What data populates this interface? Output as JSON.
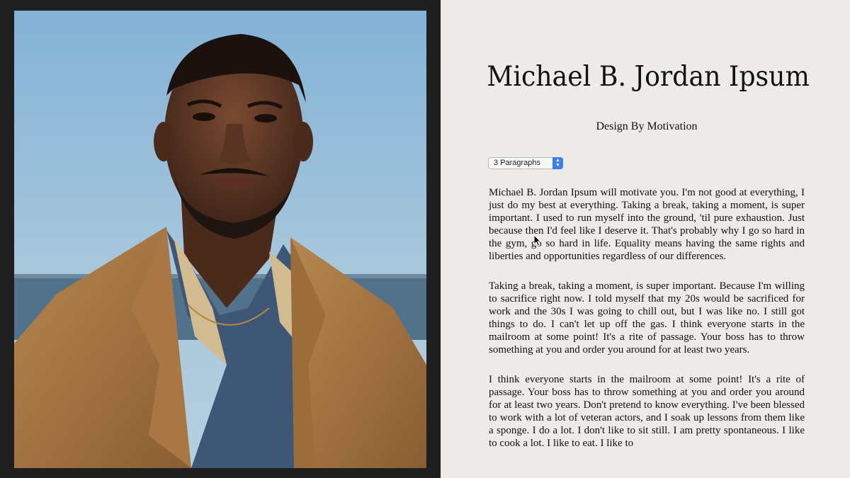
{
  "page": {
    "title": "Michael B. Jordan Ipsum",
    "subtitle": "Design By Motivation"
  },
  "controls": {
    "paragraph_select": {
      "selected": "3 Paragraphs"
    }
  },
  "content": {
    "paragraphs": [
      "Michael B. Jordan Ipsum will motivate you. I'm not good at everything, I just do my best at everything. Taking a break, taking a moment, is super important. I used to run myself into the ground, 'til pure exhaustion. Just because then I'd feel like I deserve it. That's probably why I go so hard in the gym, go so hard in life. Equality means having the same rights and liberties and opportunities regardless of our differences.",
      "Taking a break, taking a moment, is super important. Because I'm willing to sacrifice right now. I told myself that my 20s would be sacrificed for work and the 30s I was going to chill out, but I was like no. I still got things to do. I can't let up off the gas. I think everyone starts in the mailroom at some point! It's a rite of passage. Your boss has to throw something at you and order you around for at least two years.",
      "I think everyone starts in the mailroom at some point! It's a rite of passage. Your boss has to throw something at you and order you around for at least two years. Don't pretend to know everything. I've been blessed to work with a lot of veteran actors, and I soak up lessons from them like a sponge. I do a lot. I don't like to sit still. I am pretty spontaneous. I like to cook a lot. I like to eat. I like to"
    ]
  },
  "colors": {
    "left_background": "#1f1f20",
    "right_background": "#ecebe7",
    "select_accent": "#3d7fe6"
  }
}
